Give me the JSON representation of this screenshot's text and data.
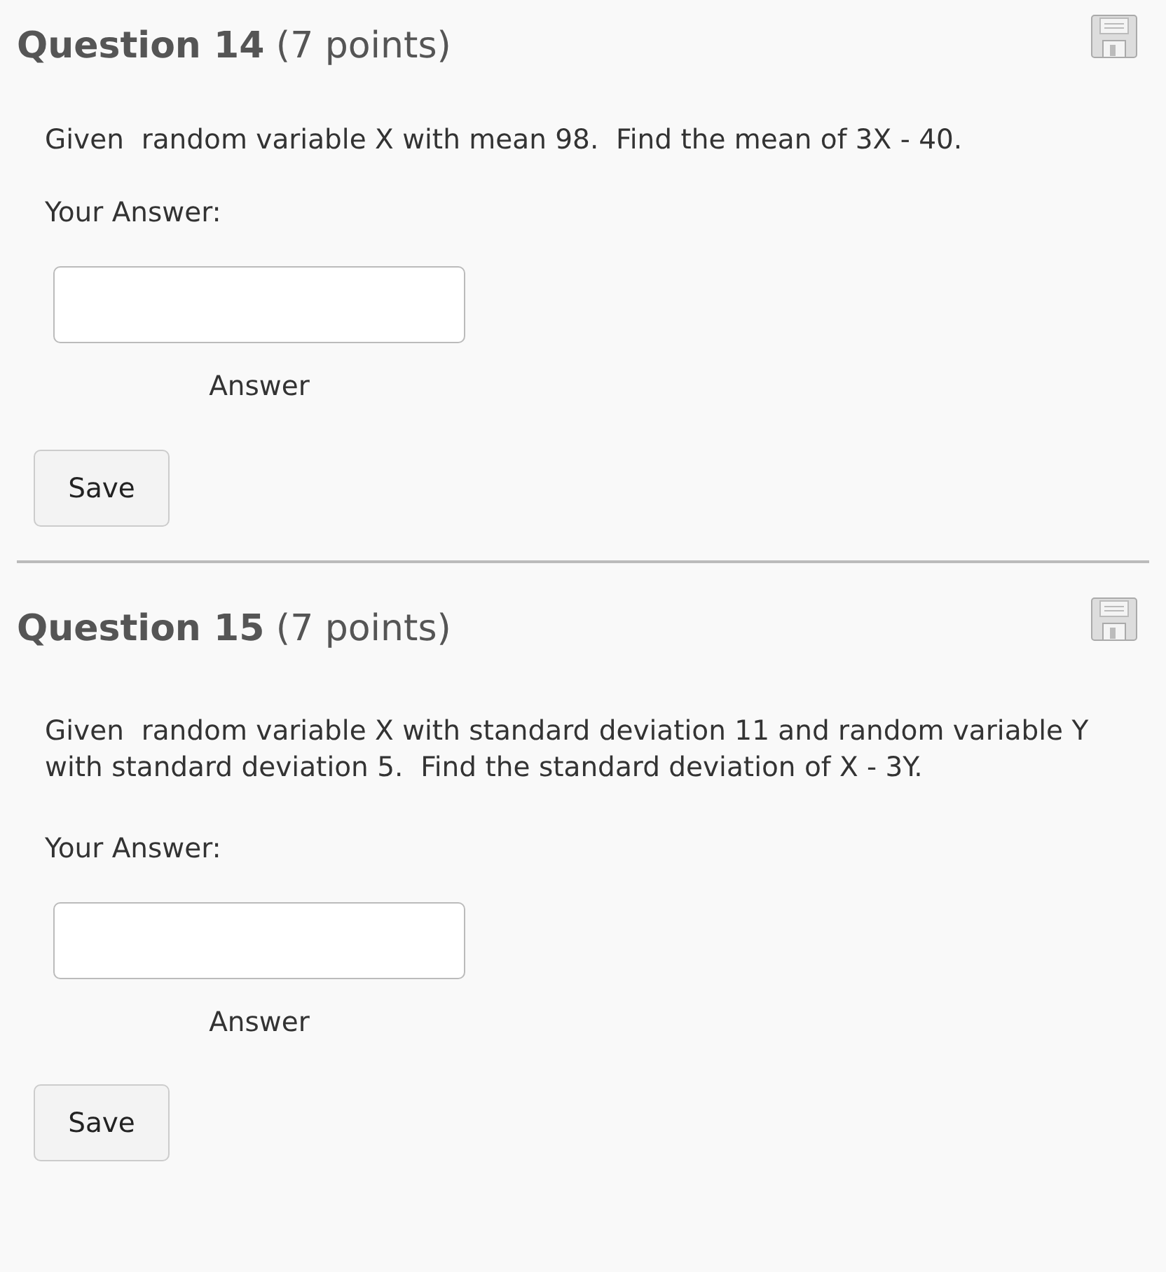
{
  "questions": [
    {
      "heading": "**Question 14** (7 points)",
      "text": "Given  random variable X with mean 98.  Find the mean of 3X - 40.",
      "answer_label": "Your Answer:",
      "field_caption": "Answer",
      "button": "Save"
    },
    {
      "heading": "**Question 15** (7 points)",
      "text": "Given  random variable X with standard deviation 11 and random variable Y with standard deviation 5.  Find the standard deviation of X - 3Y.",
      "answer_label": "Your Answer:",
      "field_caption": "Answer",
      "button": "Save"
    }
  ]
}
